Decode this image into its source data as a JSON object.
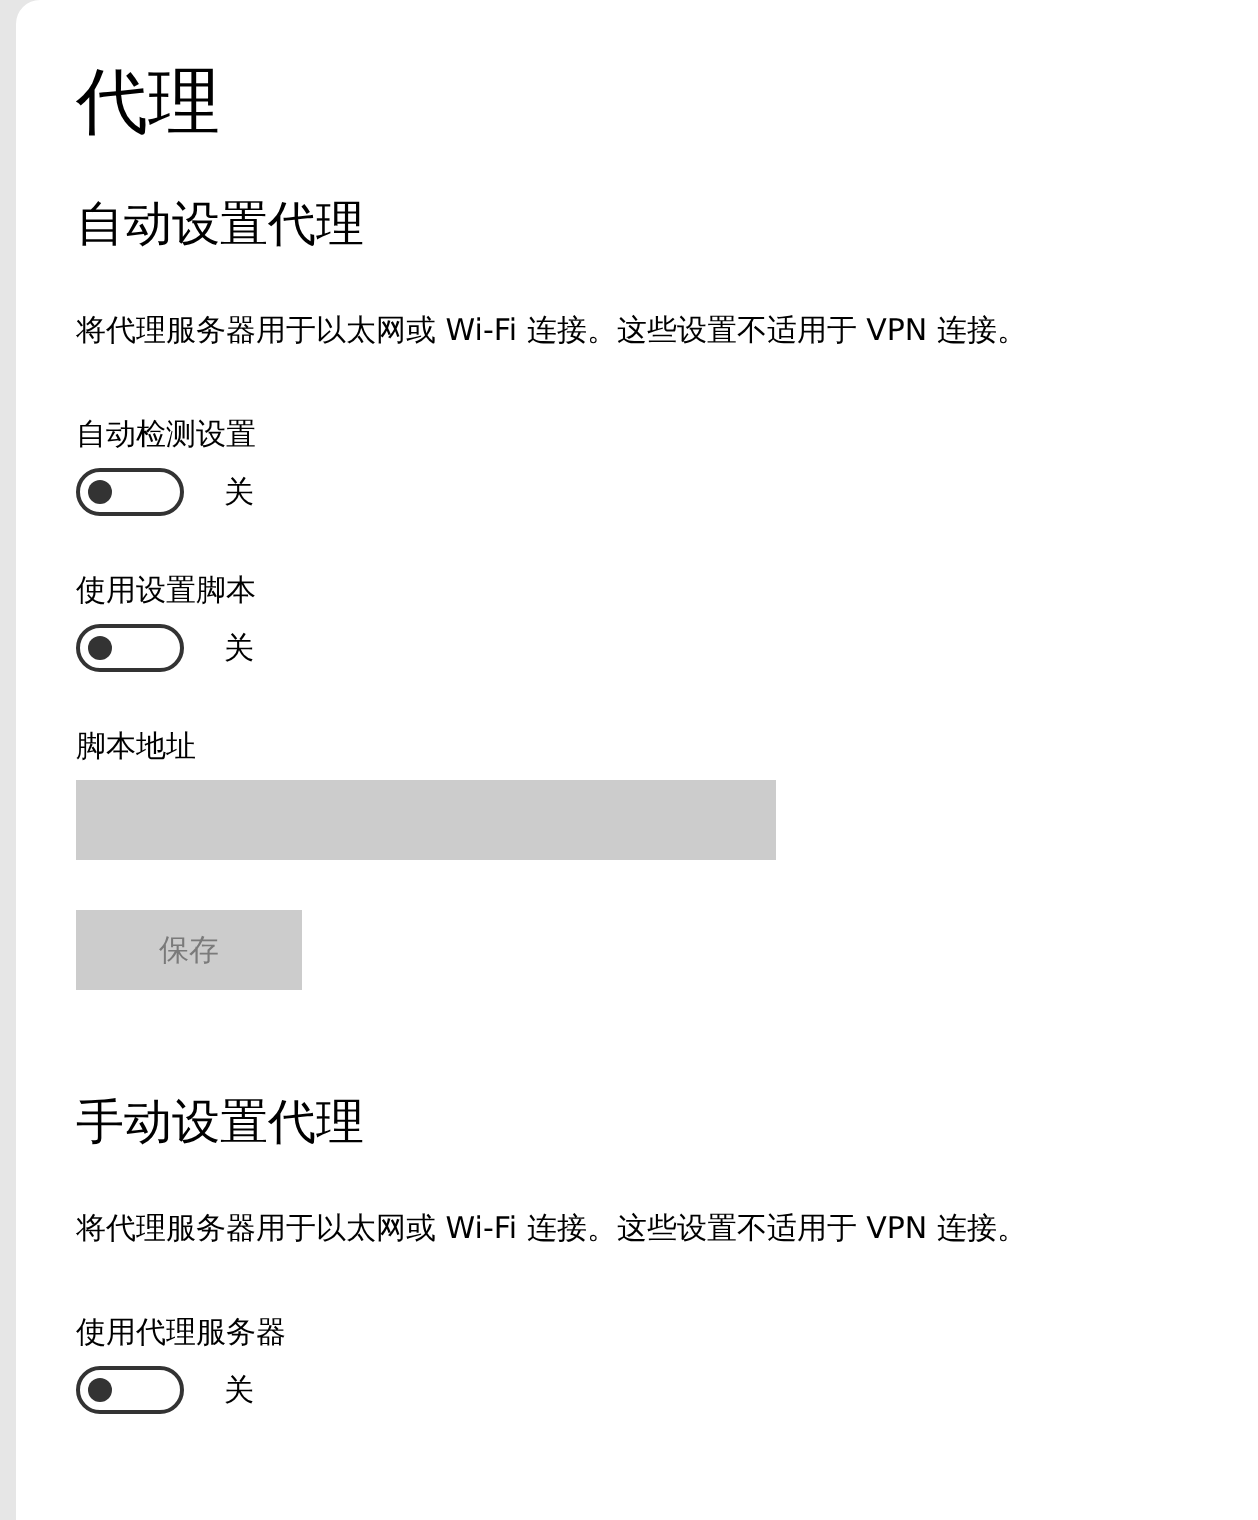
{
  "title": "代理",
  "sections": [
    {
      "heading": "自动设置代理",
      "description": "将代理服务器用于以太网或 Wi-Fi 连接。这些设置不适用于 VPN 连接。",
      "items": [
        {
          "kind": "toggle",
          "label": "自动检测设置",
          "on": false,
          "state_text": "关"
        },
        {
          "kind": "toggle",
          "label": "使用设置脚本",
          "on": false,
          "state_text": "关"
        },
        {
          "kind": "field",
          "label": "脚本地址",
          "disabled": true
        },
        {
          "kind": "button",
          "label": "保存",
          "disabled": true
        }
      ]
    },
    {
      "heading": "手动设置代理",
      "description": "将代理服务器用于以太网或 Wi-Fi 连接。这些设置不适用于 VPN 连接。",
      "items": [
        {
          "kind": "toggle",
          "label": "使用代理服务器",
          "on": false,
          "state_text": "关"
        }
      ]
    }
  ]
}
